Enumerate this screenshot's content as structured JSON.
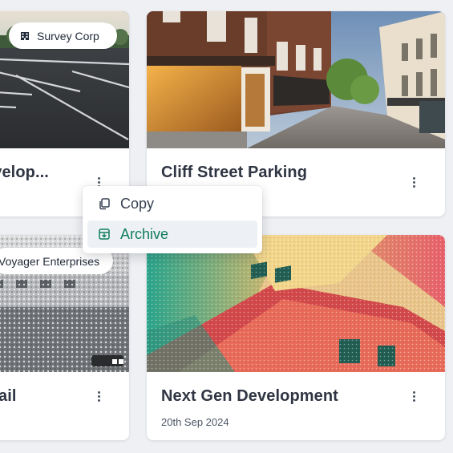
{
  "cards": [
    {
      "title": "evelop...",
      "badge": "Survey Corp",
      "badge_icon": "building-icon"
    },
    {
      "title": "Cliff Street Parking"
    },
    {
      "title": "etail",
      "badge": "Voyager Enterprises"
    },
    {
      "title": "Next Gen Development",
      "date": "20th Sep 2024"
    }
  ],
  "context_menu": {
    "items": [
      {
        "label": "Copy",
        "icon": "copy-icon"
      },
      {
        "label": "Archive",
        "icon": "archive-icon"
      }
    ]
  },
  "colors": {
    "page_background": "#eef0f3",
    "card_background": "#ffffff",
    "title_text": "#2f3542",
    "archive_accent": "#0f7c5c",
    "archive_hover_bg": "#edf1f5"
  }
}
